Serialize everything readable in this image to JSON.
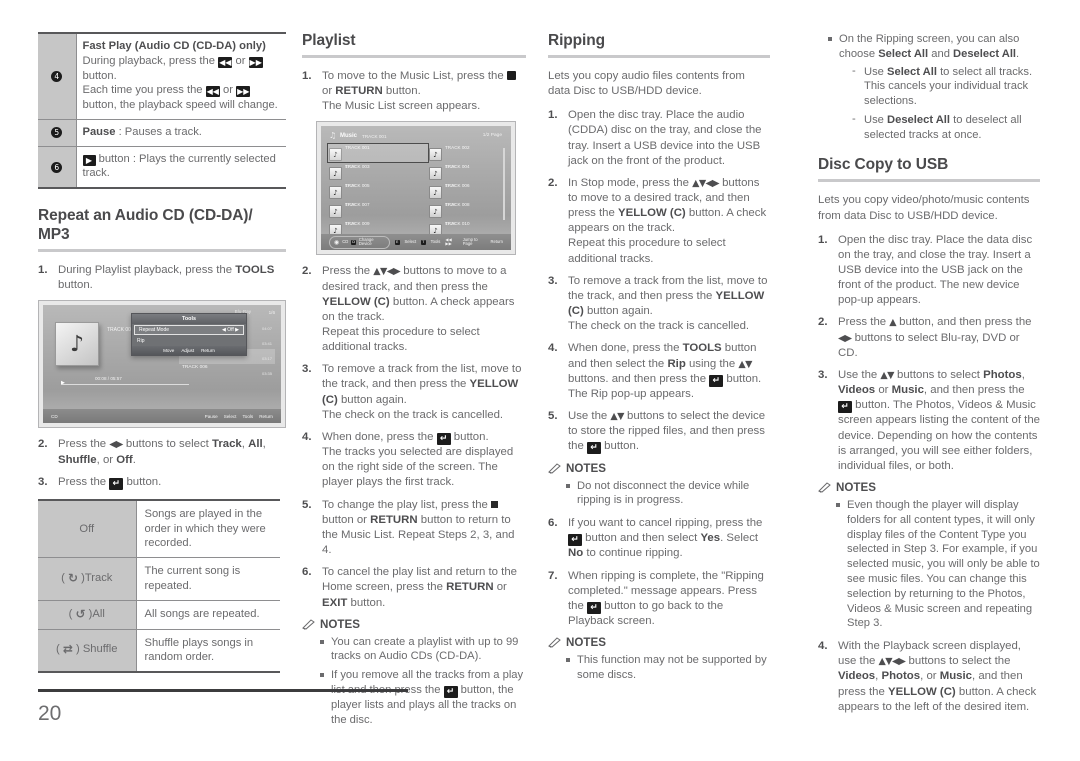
{
  "page": {
    "number": "20"
  },
  "col1": {
    "function_table": {
      "rows": [
        {
          "num": "4",
          "title": "Fast Play (Audio CD (CD-DA) only)",
          "line1_pre": "During playback, press the ",
          "line1_mid": " or ",
          "line1_post": " button.",
          "line2_pre": "Each time you press the ",
          "line2_mid": " or ",
          "line2_post": " button, the playback speed will change.",
          "icon_rew": "rewind-icon",
          "icon_ff": "fast-forward-icon"
        },
        {
          "num": "5",
          "label": "Pause",
          "text": " : Pauses a track."
        },
        {
          "num": "6",
          "icon": "play-icon",
          "text": " button : Plays the currently selected track."
        }
      ]
    },
    "repeat_heading": "Repeat an Audio CD (CD-DA)/ MP3",
    "steps": [
      {
        "n": "1.",
        "pre": "During Playlist playback, press the ",
        "bold": "TOOLS",
        "post": " button."
      },
      {
        "n": "2.",
        "pre": "Press the ",
        "arrows": "◀▶",
        "mid": " buttons to select ",
        "b1": "Track",
        "s1": ", ",
        "b2": "All",
        "s2": ", ",
        "b3": "Shuffle",
        "s3": ", or ",
        "b4": "Off",
        "post": "."
      },
      {
        "n": "3.",
        "pre": "Press the ",
        "icon": "enter-icon",
        "post": " button."
      }
    ],
    "tools_screenshot": {
      "name": "tools-popup-screenshot",
      "header_blu": "Blu-Ray",
      "page_indicator": "1/6",
      "track_label": "TRACK 001",
      "time": "00:08 / 05:57",
      "popup_title": "Tools",
      "popup_rows": [
        {
          "label": "Repeat Mode",
          "value": "Off"
        },
        {
          "label": "Rip",
          "value": ""
        }
      ],
      "popup_footer": [
        "Move",
        "Adjust",
        "Return"
      ],
      "tracks": [
        {
          "name": "TRACK 003",
          "dur": "04:07",
          "hl": false
        },
        {
          "name": "TRACK 004",
          "dur": "03:41",
          "hl": false
        },
        {
          "name": "TRACK 005",
          "dur": "03:17",
          "hl": true
        },
        {
          "name": "TRACK 006",
          "dur": "03:35",
          "hl": false
        }
      ],
      "bottom_left": "CD",
      "bottom_right": [
        "Pause",
        "Select",
        "Tools",
        "Return"
      ]
    },
    "mode_table": {
      "rows": [
        {
          "key_icon": "",
          "key": "Off",
          "desc": "Songs are played in the order in which they were recorded."
        },
        {
          "key_icon": "repeat-one-icon",
          "key": "( ↺ )Track",
          "desc": "The current song is repeated."
        },
        {
          "key_icon": "repeat-all-icon",
          "key": "( ↺ )All",
          "desc": "All songs are repeated."
        },
        {
          "key_icon": "shuffle-icon",
          "key": "( ⇄ ) Shuffle",
          "desc": "Shuffle plays songs in random order."
        }
      ]
    }
  },
  "col2": {
    "heading": "Playlist",
    "steps": [
      {
        "n": "1.",
        "html_pre": "To move to the Music List, press the ",
        "icon": "stop-icon",
        "mid": " or ",
        "bold": "RETURN",
        "post": " button.",
        "line2": "The Music List screen appears."
      },
      {
        "n": "2.",
        "pre": "Press the ",
        "arrows": "▲▼◀▶",
        "mid": " buttons to move to a desired track, and then press the ",
        "bold": "YELLOW (C)",
        "post": " button. A check appears on the track.",
        "line2": "Repeat this procedure to select additional tracks."
      },
      {
        "n": "3.",
        "pre": "To remove a track from the list, move to the track, and then press the ",
        "bold": "YELLOW (C)",
        "post": " button again.",
        "line2": "The check on the track is cancelled."
      },
      {
        "n": "4.",
        "pre": "When done, press the ",
        "icon": "enter-icon",
        "post": " button.",
        "line2": "The tracks you selected are displayed on the right side of the screen. The player plays the first track."
      },
      {
        "n": "5.",
        "pre": "To change the play list, press the ",
        "icon": "stop-icon",
        "mid": " button or ",
        "bold": "RETURN",
        "post": " button to return to the Music List. Repeat Steps 2, 3, and 4."
      },
      {
        "n": "6.",
        "pre": "To cancel the play list and return to the Home screen, press the ",
        "bold": "RETURN",
        "mid": " or ",
        "bold2": "EXIT",
        "post": " button."
      }
    ],
    "music_screenshot": {
      "name": "music-list-screenshot",
      "title": "Music",
      "subtitle": "TRACK 001",
      "page": "1/2 Page",
      "left_tracks": [
        {
          "name": "TRACK 001",
          "time": "02:38"
        },
        {
          "name": "TRACK 003",
          "time": "02:38"
        },
        {
          "name": "TRACK 005",
          "time": "02:38"
        },
        {
          "name": "TRACK 007",
          "time": "02:38"
        },
        {
          "name": "TRACK 009",
          "time": "02:38"
        }
      ],
      "right_tracks": [
        {
          "name": "TRACK 002",
          "time": "02:38"
        },
        {
          "name": "TRACK 004",
          "time": "02:38"
        },
        {
          "name": "TRACK 006",
          "time": "02:38"
        },
        {
          "name": "TRACK 008",
          "time": "02:38"
        },
        {
          "name": "TRACK 010",
          "time": "02:38"
        }
      ],
      "bottom_cd": "CD",
      "bottom_change": "Change Device",
      "bottom_select": "Select",
      "bottom_tools": "Tools",
      "bottom_jump": "Jump to Page",
      "bottom_return": "Return"
    },
    "notes": {
      "title": "NOTES",
      "items": [
        {
          "text": "You can create a playlist with up to 99 tracks on Audio CDs (CD-DA)."
        },
        {
          "pre": "If you remove all the tracks from a play list and then press the ",
          "icon": "enter-icon",
          "post": " button, the player lists and plays all the tracks on the disc."
        }
      ]
    }
  },
  "col3": {
    "heading": "Ripping",
    "intro": "Lets you copy audio files contents from data Disc to USB/HDD device.",
    "steps": [
      {
        "n": "1.",
        "text": "Open the disc tray. Place the audio (CDDA) disc on the tray, and close the tray. Insert a USB device into the USB jack on the front of the product."
      },
      {
        "n": "2.",
        "pre": "In Stop mode, press the ",
        "arrows": "▲▼◀▶",
        "mid": " buttons to move to a desired track, and then press the ",
        "bold": "YELLOW (C)",
        "post": " button. A check appears on the track.",
        "line2": "Repeat this procedure to select additional tracks."
      },
      {
        "n": "3.",
        "pre": "To remove a track from the list, move to the track, and then press the ",
        "bold": "YELLOW (C)",
        "post": " button again.",
        "line2": "The check on the track is cancelled."
      },
      {
        "n": "4.",
        "pre": "When done, press the ",
        "bold": "TOOLS",
        "mid": " button and then select the ",
        "bold2": "Rip",
        "mid2": " using the ",
        "arrows": "▲▼",
        "mid3": " buttons. and then press the ",
        "icon": "enter-icon",
        "post": " button. The Rip pop-up appears."
      },
      {
        "n": "5.",
        "pre": "Use the ",
        "arrows": "▲▼",
        "mid": " buttons to select the device to store the ripped files, and then press the ",
        "icon": "enter-icon",
        "post": " button."
      }
    ],
    "notes1": {
      "title": "NOTES",
      "items": [
        {
          "text": "Do not disconnect the device while ripping is in progress."
        }
      ]
    },
    "steps2": [
      {
        "n": "6.",
        "pre": "If you want to cancel ripping, press the ",
        "icon": "enter-icon",
        "mid": " button and then select ",
        "bold": "Yes",
        "mid2": ". Select ",
        "bold2": "No",
        "post": " to continue ripping."
      },
      {
        "n": "7.",
        "pre": "When ripping is complete, the \"Ripping completed.\" message appears. Press the ",
        "icon": "enter-icon",
        "post": " button to go back to the Playback screen."
      }
    ],
    "notes2": {
      "title": "NOTES",
      "items": [
        {
          "text": "This function may not be supported by some discs."
        }
      ]
    }
  },
  "col4": {
    "notes_top": {
      "items": [
        {
          "pre": "On the Ripping screen, you can also choose ",
          "bold": "Select All",
          "mid": " and ",
          "bold2": "Deselect All",
          "post": "."
        }
      ],
      "dashes": [
        {
          "pre": "Use ",
          "bold": "Select All",
          "post": " to select all tracks. This cancels your individual track selections."
        },
        {
          "pre": "Use ",
          "bold": "Deselect All",
          "post": " to deselect all selected tracks at once."
        }
      ]
    },
    "heading": "Disc Copy to USB",
    "intro": "Lets you copy video/photo/music contents from data Disc to USB/HDD device.",
    "steps": [
      {
        "n": "1.",
        "text": "Open the disc tray. Place the data disc on the tray, and close the tray. Insert a USB device into the USB jack on the front of the product. The new device pop-up appears."
      },
      {
        "n": "2.",
        "pre": "Press the ",
        "arrows": "▲",
        "mid": " button, and then press the ",
        "arrows2": "◀▶",
        "post": " buttons to select Blu-ray, DVD or CD."
      },
      {
        "n": "3.",
        "pre": "Use the ",
        "arrows": "▲▼",
        "mid": " buttons to select ",
        "bold": "Photos",
        "s1": ", ",
        "bold2": "Videos",
        "s2": " or ",
        "bold3": "Music",
        "mid2": ", and then press the ",
        "icon": "enter-icon",
        "post": " button. The Photos, Videos & Music screen appears listing the content of the device. Depending on how the contents is arranged, you will see either folders, individual files, or both."
      }
    ],
    "notes": {
      "title": "NOTES",
      "items": [
        {
          "text": "Even though the player will display folders for all content types, it will only display files of the Content Type you selected in Step 3. For example, if you selected music, you will only be able to see music files. You can change this selection by returning to the Photos, Videos & Music screen and repeating Step 3."
        }
      ]
    },
    "steps2": [
      {
        "n": "4.",
        "pre": "With the Playback screen displayed, use the ",
        "arrows": "▲▼◀▶",
        "mid": " buttons to select the ",
        "bold": "Videos",
        "s1": ", ",
        "bold2": "Photos",
        "s2": ", or ",
        "bold3": "Music",
        "mid2": ", and then press the ",
        "bold4": "YELLOW (C)",
        "post": " button. A check appears to the left of the desired item."
      }
    ]
  },
  "icons": {
    "rewind": "◀◀",
    "fast_forward": "▶▶",
    "play": "▶",
    "stop": "",
    "enter": "↵"
  },
  "colors": {
    "body_text": "#6b6b6d",
    "bold_text": "#4e4e50",
    "rule": "#c9c9cb",
    "table_header_bg": "#c6c6c6",
    "table_border": "#8e8e90",
    "table_outer": "#58585a"
  }
}
